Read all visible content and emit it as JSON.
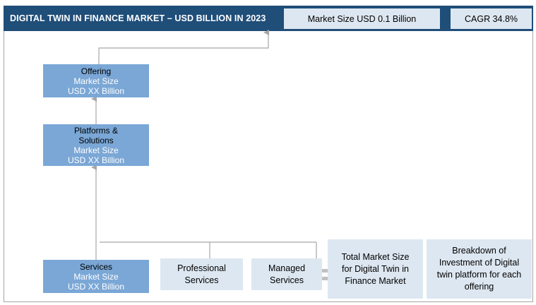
{
  "header": {
    "title": "DIGITAL TWIN IN FINANCE MARKET – USD  BILLION IN 2023",
    "market_size": "Market Size USD 0.1 Billion",
    "cagr": "CAGR 34.8%"
  },
  "nodes": {
    "offering": {
      "name": "Offering",
      "line1": "Market Size",
      "line2": "USD XX Billion"
    },
    "platforms": {
      "name": "Platforms & Solutions",
      "line1": "Market Size",
      "line2": "USD XX Billion"
    },
    "services": {
      "name": "Services",
      "line1": "Market Size",
      "line2": "USD XX Billion"
    },
    "professional": {
      "name": "Professional Services"
    },
    "managed": {
      "name": "Managed Services"
    },
    "total": {
      "name": "Total Market Size for Digital Twin in Finance Market"
    },
    "breakdown": {
      "name": "Breakdown of Investment of Digital twin platform for each offering"
    }
  },
  "colors": {
    "header": "#1f4e79",
    "node_dark": "#7aa7d6",
    "node_light": "#dde7f1",
    "connector": "#a6a6a6"
  }
}
